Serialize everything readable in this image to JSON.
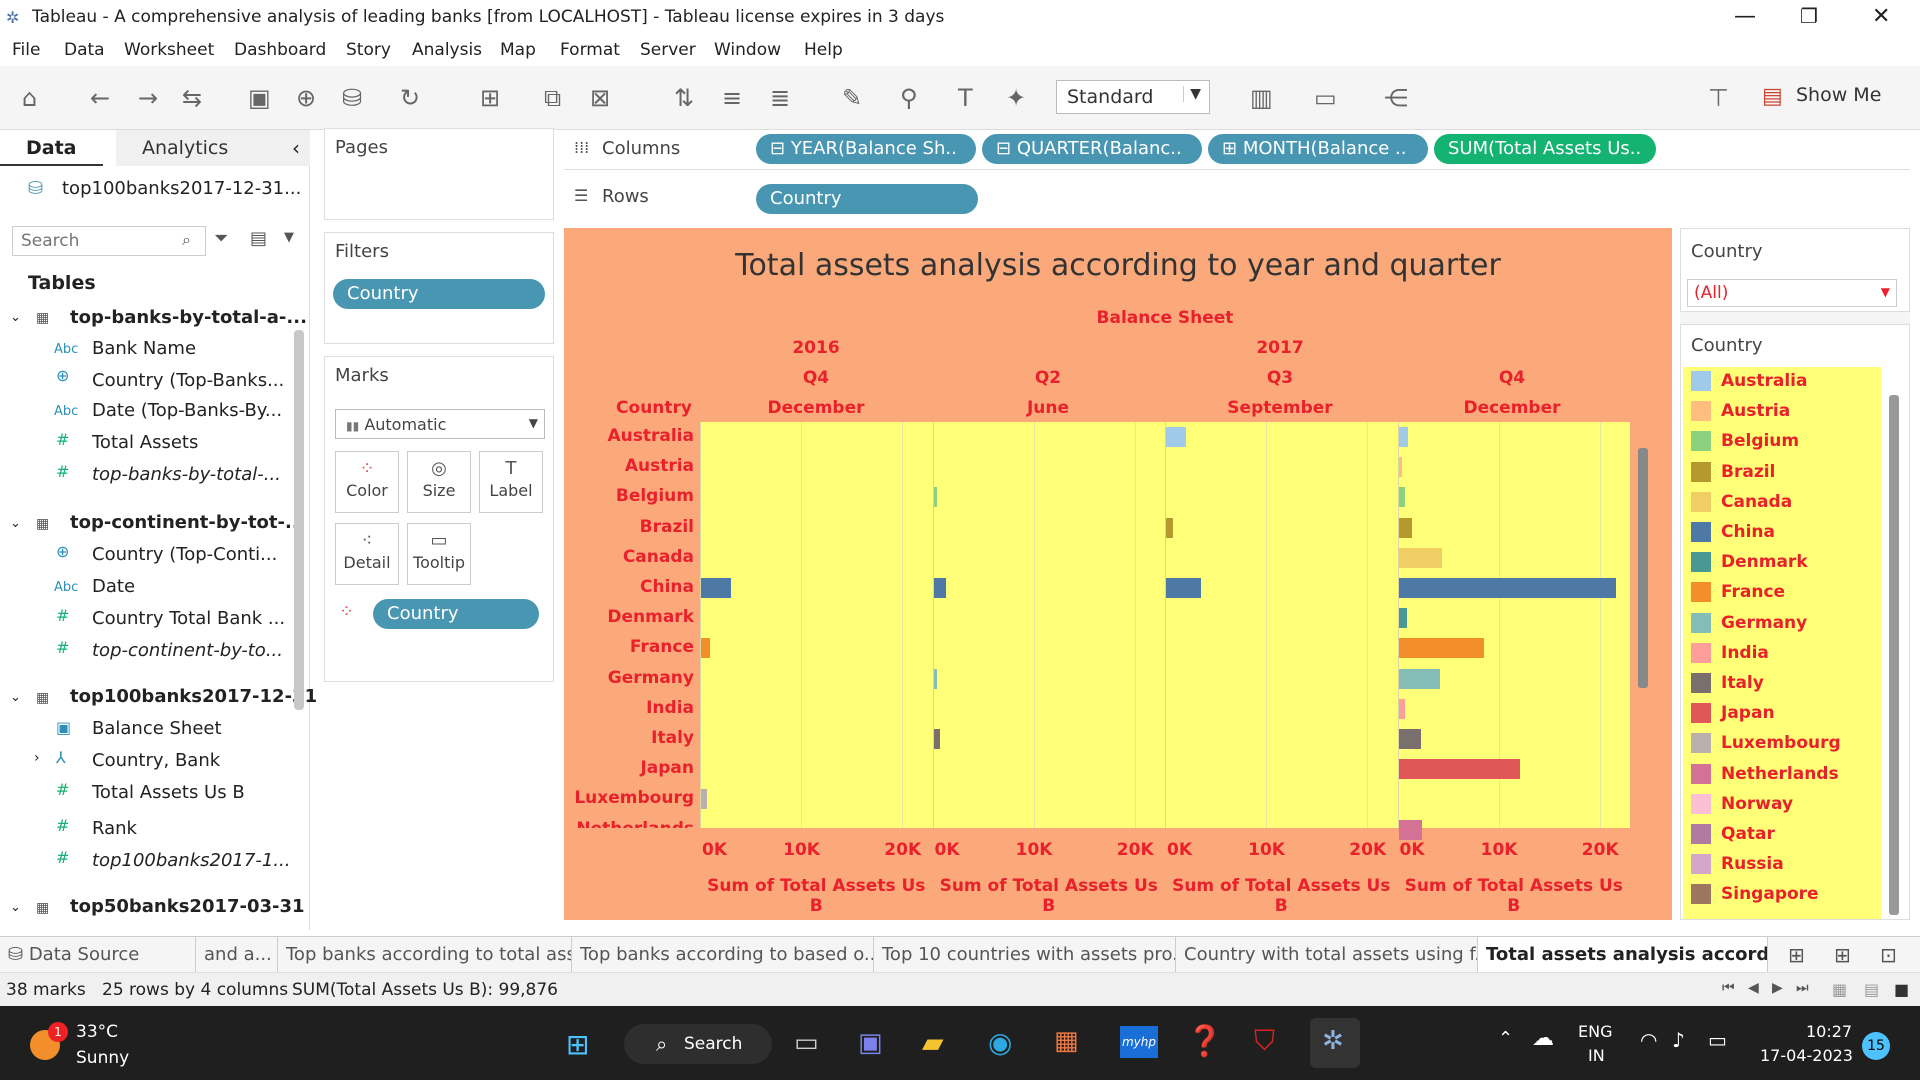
{
  "window": {
    "title": "Tableau - A comprehensive analysis of leading banks [from LOCALHOST] - Tableau license expires in 3 days"
  },
  "menu": [
    "File",
    "Data",
    "Worksheet",
    "Dashboard",
    "Story",
    "Analysis",
    "Map",
    "Format",
    "Server",
    "Window",
    "Help"
  ],
  "toolbar": {
    "fit": "Standard",
    "show_me": "Show Me"
  },
  "left": {
    "tab_data": "Data",
    "tab_analytics": "Analytics",
    "source": "top100banks2017-12-31...",
    "search_placeholder": "Search",
    "tables_label": "Tables",
    "groups": [
      {
        "name": "top-banks-by-total-a-...",
        "fields": [
          {
            "type": "Abc",
            "name": "Bank Name"
          },
          {
            "type": "geo",
            "name": "Country (Top-Banks..."
          },
          {
            "type": "Abc",
            "name": "Date (Top-Banks-By..."
          },
          {
            "type": "#",
            "name": "Total Assets"
          },
          {
            "type": "#",
            "name": "top-banks-by-total-..."
          }
        ]
      },
      {
        "name": "top-continent-by-tot-...",
        "fields": [
          {
            "type": "geo",
            "name": "Country (Top-Conti..."
          },
          {
            "type": "Abc",
            "name": "Date"
          },
          {
            "type": "#",
            "name": "Country Total Bank ..."
          },
          {
            "type": "#",
            "name": "top-continent-by-to..."
          }
        ]
      },
      {
        "name": "top100banks2017-12-31",
        "fields": [
          {
            "type": "cal",
            "name": "Balance Sheet"
          },
          {
            "type": "hier",
            "name": "Country, Bank"
          },
          {
            "type": "#",
            "name": "Total Assets Us B"
          },
          {
            "type": "#",
            "name": "Rank"
          },
          {
            "type": "#",
            "name": "top100banks2017-1..."
          }
        ]
      },
      {
        "name": "top50banks2017-03-31",
        "fields": []
      }
    ]
  },
  "pages": {
    "label": "Pages"
  },
  "filters": {
    "label": "Filters",
    "pill": "Country"
  },
  "marks": {
    "label": "Marks",
    "type": "Automatic",
    "buttons": [
      "Color",
      "Size",
      "Label",
      "Detail",
      "Tooltip"
    ],
    "pill": "Country"
  },
  "shelves": {
    "columns_label": "Columns",
    "rows_label": "Rows",
    "columns": [
      "YEAR(Balance Sh..",
      "QUARTER(Balanc..",
      "MONTH(Balance ..",
      "SUM(Total Assets Us.."
    ],
    "rows": [
      "Country"
    ]
  },
  "chart_data": {
    "type": "bar",
    "title": "Total assets analysis according to year and quarter",
    "header_top": "Balance Sheet",
    "column_header": "Country",
    "panels": [
      {
        "year": "2016",
        "quarter": "Q4",
        "month": "December"
      },
      {
        "year": "2017",
        "quarter": "Q2",
        "month": "June"
      },
      {
        "year": "",
        "quarter": "Q3",
        "month": "September"
      },
      {
        "year": "",
        "quarter": "Q4",
        "month": "December"
      }
    ],
    "categories": [
      "Australia",
      "Austria",
      "Belgium",
      "Brazil",
      "Canada",
      "China",
      "Denmark",
      "France",
      "Germany",
      "India",
      "Italy",
      "Japan",
      "Luxembourg",
      "Netherlands"
    ],
    "series": [
      {
        "panel": 0,
        "values": [
          0,
          0,
          0,
          0,
          0,
          3000,
          0,
          900,
          0,
          0,
          0,
          0,
          600,
          0
        ]
      },
      {
        "panel": 1,
        "values": [
          0,
          0,
          200,
          0,
          0,
          1200,
          0,
          0,
          200,
          0,
          600,
          0,
          0,
          0
        ]
      },
      {
        "panel": 2,
        "values": [
          2000,
          0,
          0,
          700,
          0,
          3500,
          0,
          0,
          0,
          0,
          0,
          0,
          0,
          0
        ]
      },
      {
        "panel": 3,
        "values": [
          900,
          300,
          600,
          1300,
          4300,
          21500,
          800,
          8500,
          4100,
          600,
          2200,
          12000,
          0,
          2300
        ]
      }
    ],
    "xticks": [
      "0K",
      "10K",
      "20K"
    ],
    "xlim": [
      0,
      21800
    ],
    "xlabel": "Sum of Total Assets Us B",
    "grid": true,
    "legend": "right"
  },
  "legend": {
    "filter_title": "Country",
    "filter_value": "(All)",
    "title": "Country",
    "items": [
      {
        "name": "Australia",
        "color": "#a0cbe8"
      },
      {
        "name": "Austria",
        "color": "#ffbe7d"
      },
      {
        "name": "Belgium",
        "color": "#8cd17d"
      },
      {
        "name": "Brazil",
        "color": "#b6992d"
      },
      {
        "name": "Canada",
        "color": "#f1ce63"
      },
      {
        "name": "China",
        "color": "#4e79a7"
      },
      {
        "name": "Denmark",
        "color": "#499894"
      },
      {
        "name": "France",
        "color": "#f28e2b"
      },
      {
        "name": "Germany",
        "color": "#86bcb6"
      },
      {
        "name": "India",
        "color": "#ff9d9a"
      },
      {
        "name": "Italy",
        "color": "#79706e"
      },
      {
        "name": "Japan",
        "color": "#e15759"
      },
      {
        "name": "Luxembourg",
        "color": "#bab0ac"
      },
      {
        "name": "Netherlands",
        "color": "#d37295"
      },
      {
        "name": "Norway",
        "color": "#fabfd2"
      },
      {
        "name": "Qatar",
        "color": "#b07aa1"
      },
      {
        "name": "Russia",
        "color": "#d4a6c8"
      },
      {
        "name": "Singapore",
        "color": "#9d7660"
      }
    ]
  },
  "sheettabs": [
    "Data Source",
    "and a...",
    "Top banks according to total ass...",
    "Top banks according to based o...",
    "Top 10 countries with assets pro...",
    "Country with total assets using f...",
    "Total assets analysis accordin..."
  ],
  "status": {
    "marks": "38 marks",
    "dims": "25 rows by 4 columns",
    "sum": "SUM(Total Assets Us B): 99,876"
  },
  "taskbar": {
    "temp": "33°C",
    "weather": "Sunny",
    "badge": "1",
    "search": "Search",
    "lang1": "ENG",
    "lang2": "IN",
    "time": "10:27",
    "date": "17-04-2023",
    "notif": "15"
  }
}
